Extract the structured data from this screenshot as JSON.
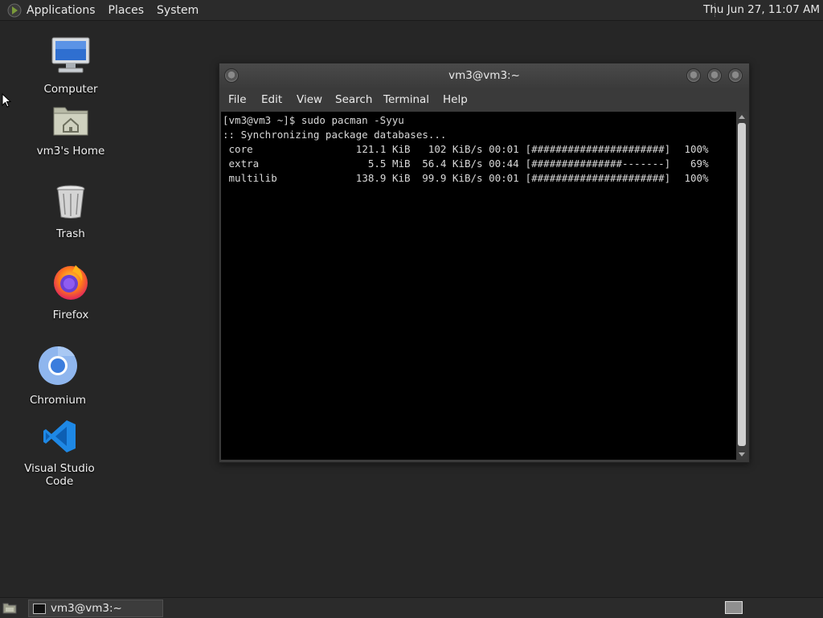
{
  "top_panel": {
    "menus": [
      "Applications",
      "Places",
      "System"
    ],
    "clock": "Thu Jun 27, 11:07 AM"
  },
  "desktop": {
    "icons": [
      {
        "label": "Computer",
        "icon": "computer-icon"
      },
      {
        "label": "vm3's Home",
        "icon": "home-folder-icon"
      },
      {
        "label": "Trash",
        "icon": "trash-icon"
      },
      {
        "label": "Firefox",
        "icon": "firefox-icon"
      },
      {
        "label": "Chromium",
        "icon": "chromium-icon"
      },
      {
        "label": "Visual Studio Code",
        "icon": "vscode-icon"
      }
    ]
  },
  "window": {
    "title": "vm3@vm3:~",
    "menu": [
      "File",
      "Edit",
      "View",
      "Search",
      "Terminal",
      "Help"
    ]
  },
  "terminal": {
    "prompt": "[vm3@vm3 ~]$ sudo pacman -Syyu",
    "status": ":: Synchronizing package databases...",
    "rows": [
      {
        "name": "core",
        "size": "121.1 KiB",
        "speed": "102 KiB/s",
        "time": "00:01",
        "bar": "[######################]",
        "percent": "100%"
      },
      {
        "name": "extra",
        "size": "5.5 MiB",
        "speed": "56.4 KiB/s",
        "time": "00:44",
        "bar": "[###############-------]",
        "percent": "69%"
      },
      {
        "name": "multilib",
        "size": "138.9 KiB",
        "speed": "99.9 KiB/s",
        "time": "00:01",
        "bar": "[######################]",
        "percent": "100%"
      }
    ]
  },
  "taskbar": {
    "task_label": "vm3@vm3:~"
  },
  "colors": {
    "desktop_bg": "#262626",
    "panel_bg": "#2b2b2b",
    "terminal_bg": "#000000",
    "firefox_orange": "#ff7a1a",
    "chromium_blue": "#3b7ddd",
    "vscode_blue": "#1e88e5"
  }
}
